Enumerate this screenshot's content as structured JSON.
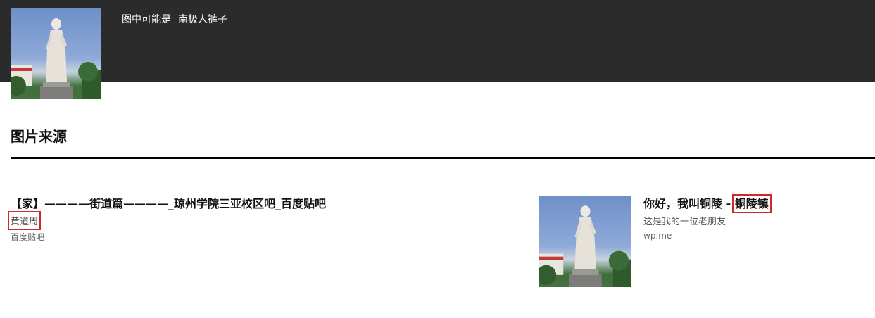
{
  "header": {
    "caption_prefix": "图中可能是",
    "caption_keyword": "南极人裤子"
  },
  "section": {
    "title": "图片来源"
  },
  "results": [
    {
      "title": "【家】————街道篇————_琼州学院三亚校区吧_百度贴吧",
      "subtitle": "黄道周",
      "source": "百度贴吧"
    },
    {
      "title_main": "你好，我叫铜陵 - ",
      "title_highlight": "铜陵镇",
      "subtitle": "这是我的一位老朋友",
      "source": "wp.me"
    }
  ],
  "colors": {
    "header_bg": "#2b2b2b",
    "highlight_box": "#d7262b"
  }
}
